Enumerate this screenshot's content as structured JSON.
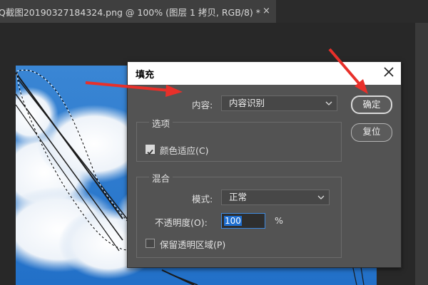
{
  "document_tab": {
    "title": "Q截图20190327184324.png @ 100% (图层 1 拷贝, RGB/8) *",
    "close_glyph": "×"
  },
  "fill_dialog": {
    "title": "填充",
    "contents_label": "内容:",
    "contents_value": "内容识别",
    "options_group": "选项",
    "color_adaptation_label": "颜色适应(C)",
    "color_adaptation_checked": true,
    "blending_group": "混合",
    "mode_label": "模式:",
    "mode_value": "正常",
    "opacity_label": "不透明度(O):",
    "opacity_value": "100",
    "opacity_unit": "%",
    "preserve_transparency_label": "保留透明区域(P)",
    "preserve_transparency_checked": false,
    "ok_button": "确定",
    "reset_button": "复位"
  },
  "annotations": {
    "arrow_color": "#e8302a"
  },
  "colors": {
    "dialog_bg": "#535353",
    "title_bg": "#ffffff",
    "sky_blue": "#2f7fd0"
  }
}
